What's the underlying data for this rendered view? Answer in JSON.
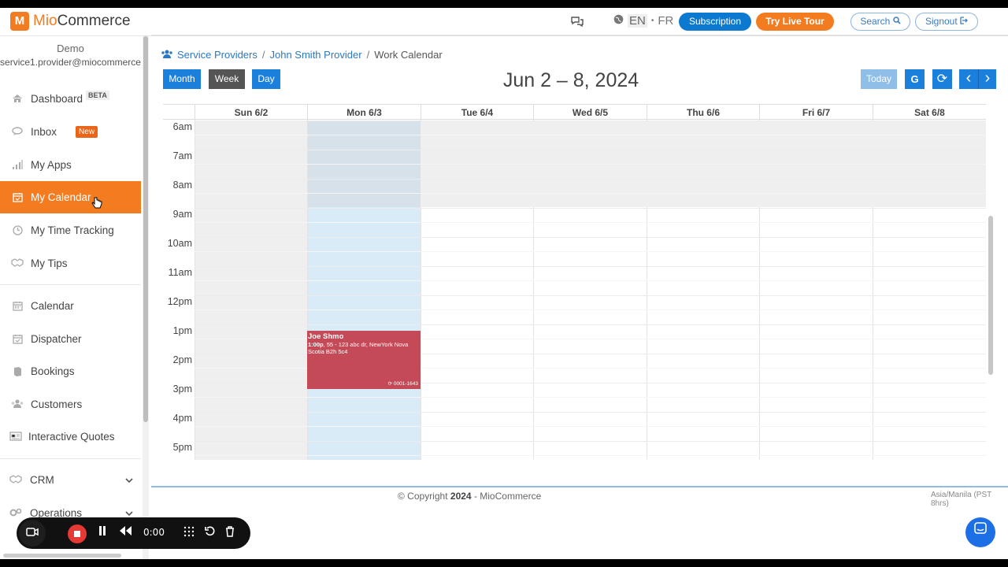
{
  "app": {
    "logo_letter": "M",
    "logo_text_accent": "Mio",
    "logo_text_rest": "Commerce"
  },
  "header": {
    "chat_icon": "chat-bubbles-icon",
    "lang_en": "EN",
    "lang_dot": "•",
    "lang_fr": "FR",
    "subscription": "Subscription",
    "live_tour": "Try Live Tour",
    "search": "Search",
    "signout": "Signout"
  },
  "sidebar": {
    "user_name": "Demo",
    "user_email": "service1.provider@miocommerce",
    "items": [
      {
        "label": "Dashboard",
        "badge": "BETA",
        "icon": "home-icon"
      },
      {
        "label": "Inbox",
        "badge": "New",
        "icon": "chat-icon"
      },
      {
        "label": "My Apps",
        "icon": "bar-signal-icon"
      },
      {
        "label": "My Calendar",
        "icon": "calendar-check-icon",
        "active": true
      },
      {
        "label": "My Time Tracking",
        "icon": "clock-icon"
      },
      {
        "label": "My Tips",
        "icon": "handshake-icon"
      },
      {
        "label": "Calendar",
        "icon": "calendar-icon"
      },
      {
        "label": "Dispatcher",
        "icon": "calendar-check-icon"
      },
      {
        "label": "Bookings",
        "icon": "book-icon"
      },
      {
        "label": "Customers",
        "icon": "users-icon"
      },
      {
        "label": "Interactive Quotes",
        "icon": "newspaper-icon"
      },
      {
        "label": "CRM",
        "icon": "handshake-icon"
      },
      {
        "label": "Operations",
        "icon": "gears-icon"
      }
    ]
  },
  "breadcrumb": {
    "item1": "Service Providers",
    "sep": "/",
    "item2": "John Smith Provider",
    "item3": "Work Calendar"
  },
  "toolbar": {
    "month": "Month",
    "week": "Week",
    "day": "Day",
    "title": "Jun 2 – 8, 2024",
    "today": "Today",
    "google": "G",
    "refresh": "⟳",
    "prev": "‹",
    "next": "›"
  },
  "days": [
    "Sun 6/2",
    "Mon 6/3",
    "Tue 6/4",
    "Wed 6/5",
    "Thu 6/6",
    "Fri 6/7",
    "Sat 6/8"
  ],
  "times": [
    "6am",
    "7am",
    "8am",
    "9am",
    "10am",
    "11am",
    "12pm",
    "1pm",
    "2pm",
    "3pm",
    "4pm",
    "5pm"
  ],
  "event": {
    "title": "Joe Shmo",
    "time": "1:00p",
    "address": ", 55 - 123 abc dr, NewYork Nova Scotia B2h 5c4",
    "code": "⟳ 0001-1643"
  },
  "footer": {
    "copyright_prefix": "© Copyright",
    "year": "2024",
    "copyright_suffix": "- MioCommerce",
    "timezone": "Asia/Manila (PST 8hrs)"
  },
  "recorder": {
    "time": "0:00"
  },
  "colors": {
    "accent": "#f47c20",
    "primary": "#0b79d0",
    "event": "#c44a57",
    "today_col": "#d9ebf7"
  }
}
